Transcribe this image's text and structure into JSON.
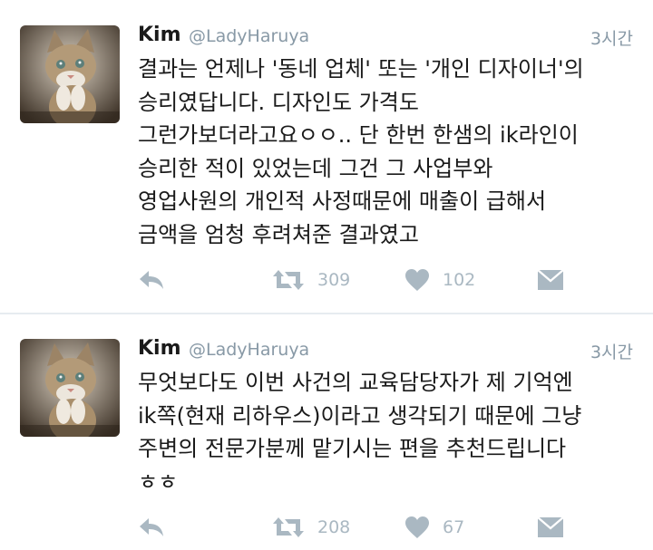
{
  "tweets": [
    {
      "author": {
        "name": "Kim",
        "handle": "@LadyHaruya"
      },
      "time": "3시간",
      "lines": [
        "결과는 언제나 '동네 업체' 또는 '개인 디자이너'의",
        "승리였답니다. 디자인도 가격도",
        "그런가보더라고요ㅇㅇ.. 단 한번 한샘의 ik라인이",
        "승리한 적이 있었는데 그건 그 사업부와",
        "영업사원의 개인적 사정때문에 매출이 급해서",
        "금액을 엄청 후려쳐준 결과였고"
      ],
      "retweets": "309",
      "likes": "102"
    },
    {
      "author": {
        "name": "Kim",
        "handle": "@LadyHaruya"
      },
      "time": "3시간",
      "lines": [
        "무엇보다도 이번 사건의 교육담당자가 제 기억엔",
        "ik쪽(현재 리하우스)이라고 생각되기 때문에 그냥",
        "주변의 전문가분께 맡기시는 편을 추천드립니다",
        "ㅎㅎ"
      ],
      "retweets": "208",
      "likes": "67"
    }
  ],
  "icons": {
    "reply": "reply-arrow-icon",
    "retweet": "retweet-icon",
    "like": "heart-icon",
    "message": "envelope-icon",
    "avatar": "kitten-photo"
  },
  "colors": {
    "text": "#1a1a1a",
    "secondary": "#8899a6",
    "action_icon": "#aab8c2",
    "divider": "#e6ecf0"
  }
}
